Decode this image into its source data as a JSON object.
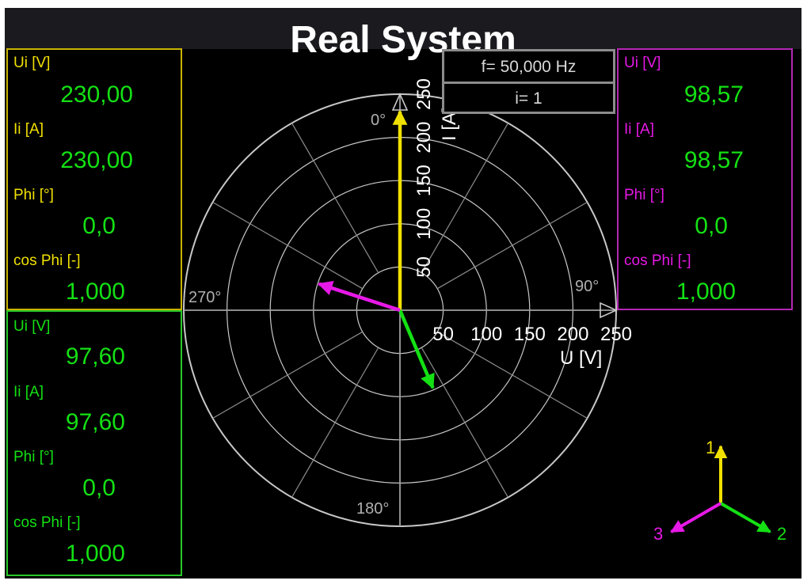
{
  "title": "Real System",
  "info": {
    "frequency": "f= 50,000 Hz",
    "index": "i= 1"
  },
  "colors": {
    "phase1": "#f0e000",
    "phase2": "#14e014",
    "phase3": "#e619e6",
    "panel1_border": "#c8b400",
    "panel2_border": "#28c828",
    "panel3_border": "#b428b4",
    "value_green": "#14e014",
    "grid": "#c8c8c8",
    "background": "#000000"
  },
  "panels": [
    {
      "phase": 1,
      "labels": {
        "ui": "Ui [V]",
        "ii": "Ii [A]",
        "phi": "Phi [°]",
        "cos": "cos Phi [-]"
      },
      "values": {
        "ui": "230,00",
        "ii": "230,00",
        "phi": "0,0",
        "cos": "1,000"
      }
    },
    {
      "phase": 2,
      "labels": {
        "ui": "Ui [V]",
        "ii": "Ii [A]",
        "phi": "Phi [°]",
        "cos": "cos Phi [-]"
      },
      "values": {
        "ui": "97,60",
        "ii": "97,60",
        "phi": "0,0",
        "cos": "1,000"
      }
    },
    {
      "phase": 3,
      "labels": {
        "ui": "Ui [V]",
        "ii": "Ii [A]",
        "phi": "Phi [°]",
        "cos": "cos Phi [-]"
      },
      "values": {
        "ui": "98,57",
        "ii": "98,57",
        "phi": "0,0",
        "cos": "1,000"
      }
    }
  ],
  "polar": {
    "angle_labels": {
      "top": "0°",
      "right": "90°",
      "bottom": "180°",
      "left": "270°"
    },
    "u_axis_label": "U [V]",
    "i_axis_label": "I [A]",
    "radial_ticks": [
      "50",
      "100",
      "150",
      "200",
      "250"
    ],
    "radial_max": 250,
    "phasors": [
      {
        "phase": 1,
        "angle_deg": 0,
        "magnitude": 230.0
      },
      {
        "phase": 2,
        "angle_deg": 157,
        "magnitude": 97.6
      },
      {
        "phase": 3,
        "angle_deg": 288,
        "magnitude": 98.57
      }
    ]
  },
  "legend": {
    "labels": [
      "1",
      "2",
      "3"
    ]
  }
}
